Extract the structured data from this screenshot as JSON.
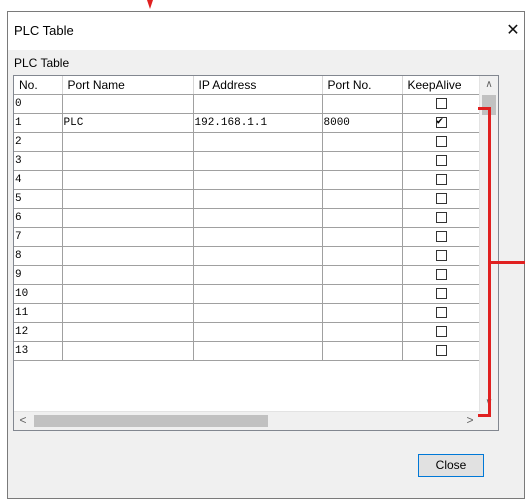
{
  "window": {
    "title": "PLC Table",
    "close_glyph": "✕"
  },
  "group_label": "PLC Table",
  "table": {
    "columns": [
      "No.",
      "Port Name",
      "IP Address",
      "Port No.",
      "KeepAlive"
    ],
    "rows": [
      {
        "no": "0",
        "port_name": "",
        "ip": "",
        "port_no": "",
        "keepalive": false
      },
      {
        "no": "1",
        "port_name": "PLC",
        "ip": "192.168.1.1",
        "port_no": "8000",
        "keepalive": true
      },
      {
        "no": "2",
        "port_name": "",
        "ip": "",
        "port_no": "",
        "keepalive": false
      },
      {
        "no": "3",
        "port_name": "",
        "ip": "",
        "port_no": "",
        "keepalive": false
      },
      {
        "no": "4",
        "port_name": "",
        "ip": "",
        "port_no": "",
        "keepalive": false
      },
      {
        "no": "5",
        "port_name": "",
        "ip": "",
        "port_no": "",
        "keepalive": false
      },
      {
        "no": "6",
        "port_name": "",
        "ip": "",
        "port_no": "",
        "keepalive": false
      },
      {
        "no": "7",
        "port_name": "",
        "ip": "",
        "port_no": "",
        "keepalive": false
      },
      {
        "no": "8",
        "port_name": "",
        "ip": "",
        "port_no": "",
        "keepalive": false
      },
      {
        "no": "9",
        "port_name": "",
        "ip": "",
        "port_no": "",
        "keepalive": false
      },
      {
        "no": "10",
        "port_name": "",
        "ip": "",
        "port_no": "",
        "keepalive": false
      },
      {
        "no": "11",
        "port_name": "",
        "ip": "",
        "port_no": "",
        "keepalive": false
      },
      {
        "no": "12",
        "port_name": "",
        "ip": "",
        "port_no": "",
        "keepalive": false
      },
      {
        "no": "13",
        "port_name": "",
        "ip": "",
        "port_no": "",
        "keepalive": false
      }
    ]
  },
  "scrollbars": {
    "up": "∧",
    "down": "∨",
    "left": "<",
    "right": ">"
  },
  "buttons": {
    "close_label": "Close"
  },
  "icons": {
    "checked": "✔"
  },
  "colors": {
    "annotation": "#e02020",
    "focus_border": "#0078d7"
  }
}
